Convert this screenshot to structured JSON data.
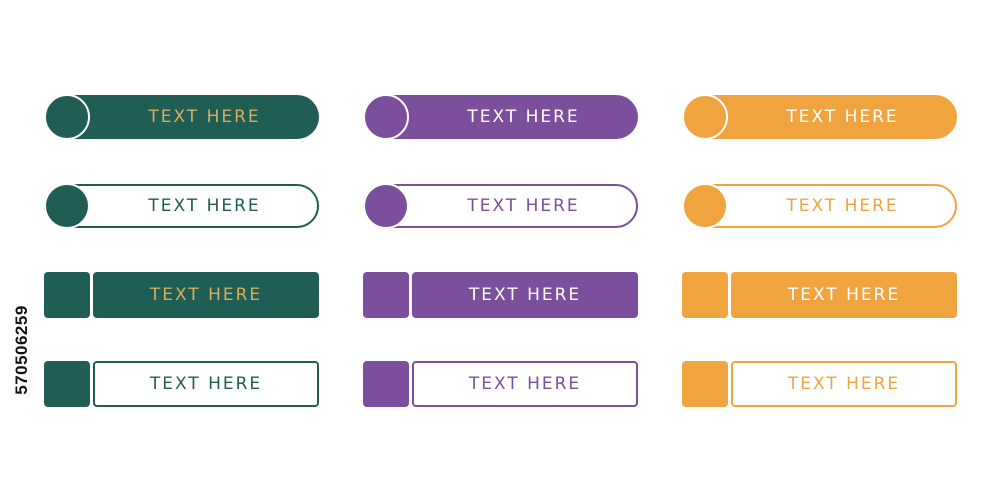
{
  "colors": {
    "green": "#1f5d55",
    "purple": "#7b4f9c",
    "orange": "#f0a43f",
    "gold_text": "#d8ad5c",
    "white": "#ffffff"
  },
  "stock_id": "570506259",
  "label_text": "TEXT HERE",
  "banners": [
    {
      "label": "TEXT HERE"
    },
    {
      "label": "TEXT HERE"
    },
    {
      "label": "TEXT HERE"
    },
    {
      "label": "TEXT HERE"
    },
    {
      "label": "TEXT HERE"
    },
    {
      "label": "TEXT HERE"
    },
    {
      "label": "TEXT HERE"
    },
    {
      "label": "TEXT HERE"
    },
    {
      "label": "TEXT HERE"
    },
    {
      "label": "TEXT HERE"
    },
    {
      "label": "TEXT HERE"
    },
    {
      "label": "TEXT HERE"
    }
  ]
}
